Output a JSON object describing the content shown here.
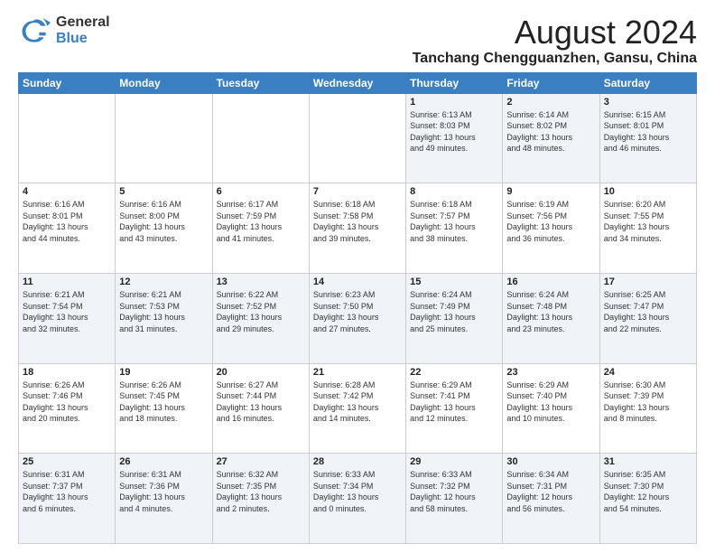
{
  "header": {
    "logo_general": "General",
    "logo_blue": "Blue",
    "month_title": "August 2024",
    "location": "Tanchang Chengguanzhen, Gansu, China"
  },
  "days_of_week": [
    "Sunday",
    "Monday",
    "Tuesday",
    "Wednesday",
    "Thursday",
    "Friday",
    "Saturday"
  ],
  "weeks": [
    [
      {
        "day": "",
        "info": ""
      },
      {
        "day": "",
        "info": ""
      },
      {
        "day": "",
        "info": ""
      },
      {
        "day": "",
        "info": ""
      },
      {
        "day": "1",
        "info": "Sunrise: 6:13 AM\nSunset: 8:03 PM\nDaylight: 13 hours\nand 49 minutes."
      },
      {
        "day": "2",
        "info": "Sunrise: 6:14 AM\nSunset: 8:02 PM\nDaylight: 13 hours\nand 48 minutes."
      },
      {
        "day": "3",
        "info": "Sunrise: 6:15 AM\nSunset: 8:01 PM\nDaylight: 13 hours\nand 46 minutes."
      }
    ],
    [
      {
        "day": "4",
        "info": "Sunrise: 6:16 AM\nSunset: 8:01 PM\nDaylight: 13 hours\nand 44 minutes."
      },
      {
        "day": "5",
        "info": "Sunrise: 6:16 AM\nSunset: 8:00 PM\nDaylight: 13 hours\nand 43 minutes."
      },
      {
        "day": "6",
        "info": "Sunrise: 6:17 AM\nSunset: 7:59 PM\nDaylight: 13 hours\nand 41 minutes."
      },
      {
        "day": "7",
        "info": "Sunrise: 6:18 AM\nSunset: 7:58 PM\nDaylight: 13 hours\nand 39 minutes."
      },
      {
        "day": "8",
        "info": "Sunrise: 6:18 AM\nSunset: 7:57 PM\nDaylight: 13 hours\nand 38 minutes."
      },
      {
        "day": "9",
        "info": "Sunrise: 6:19 AM\nSunset: 7:56 PM\nDaylight: 13 hours\nand 36 minutes."
      },
      {
        "day": "10",
        "info": "Sunrise: 6:20 AM\nSunset: 7:55 PM\nDaylight: 13 hours\nand 34 minutes."
      }
    ],
    [
      {
        "day": "11",
        "info": "Sunrise: 6:21 AM\nSunset: 7:54 PM\nDaylight: 13 hours\nand 32 minutes."
      },
      {
        "day": "12",
        "info": "Sunrise: 6:21 AM\nSunset: 7:53 PM\nDaylight: 13 hours\nand 31 minutes."
      },
      {
        "day": "13",
        "info": "Sunrise: 6:22 AM\nSunset: 7:52 PM\nDaylight: 13 hours\nand 29 minutes."
      },
      {
        "day": "14",
        "info": "Sunrise: 6:23 AM\nSunset: 7:50 PM\nDaylight: 13 hours\nand 27 minutes."
      },
      {
        "day": "15",
        "info": "Sunrise: 6:24 AM\nSunset: 7:49 PM\nDaylight: 13 hours\nand 25 minutes."
      },
      {
        "day": "16",
        "info": "Sunrise: 6:24 AM\nSunset: 7:48 PM\nDaylight: 13 hours\nand 23 minutes."
      },
      {
        "day": "17",
        "info": "Sunrise: 6:25 AM\nSunset: 7:47 PM\nDaylight: 13 hours\nand 22 minutes."
      }
    ],
    [
      {
        "day": "18",
        "info": "Sunrise: 6:26 AM\nSunset: 7:46 PM\nDaylight: 13 hours\nand 20 minutes."
      },
      {
        "day": "19",
        "info": "Sunrise: 6:26 AM\nSunset: 7:45 PM\nDaylight: 13 hours\nand 18 minutes."
      },
      {
        "day": "20",
        "info": "Sunrise: 6:27 AM\nSunset: 7:44 PM\nDaylight: 13 hours\nand 16 minutes."
      },
      {
        "day": "21",
        "info": "Sunrise: 6:28 AM\nSunset: 7:42 PM\nDaylight: 13 hours\nand 14 minutes."
      },
      {
        "day": "22",
        "info": "Sunrise: 6:29 AM\nSunset: 7:41 PM\nDaylight: 13 hours\nand 12 minutes."
      },
      {
        "day": "23",
        "info": "Sunrise: 6:29 AM\nSunset: 7:40 PM\nDaylight: 13 hours\nand 10 minutes."
      },
      {
        "day": "24",
        "info": "Sunrise: 6:30 AM\nSunset: 7:39 PM\nDaylight: 13 hours\nand 8 minutes."
      }
    ],
    [
      {
        "day": "25",
        "info": "Sunrise: 6:31 AM\nSunset: 7:37 PM\nDaylight: 13 hours\nand 6 minutes."
      },
      {
        "day": "26",
        "info": "Sunrise: 6:31 AM\nSunset: 7:36 PM\nDaylight: 13 hours\nand 4 minutes."
      },
      {
        "day": "27",
        "info": "Sunrise: 6:32 AM\nSunset: 7:35 PM\nDaylight: 13 hours\nand 2 minutes."
      },
      {
        "day": "28",
        "info": "Sunrise: 6:33 AM\nSunset: 7:34 PM\nDaylight: 13 hours\nand 0 minutes."
      },
      {
        "day": "29",
        "info": "Sunrise: 6:33 AM\nSunset: 7:32 PM\nDaylight: 12 hours\nand 58 minutes."
      },
      {
        "day": "30",
        "info": "Sunrise: 6:34 AM\nSunset: 7:31 PM\nDaylight: 12 hours\nand 56 minutes."
      },
      {
        "day": "31",
        "info": "Sunrise: 6:35 AM\nSunset: 7:30 PM\nDaylight: 12 hours\nand 54 minutes."
      }
    ]
  ]
}
